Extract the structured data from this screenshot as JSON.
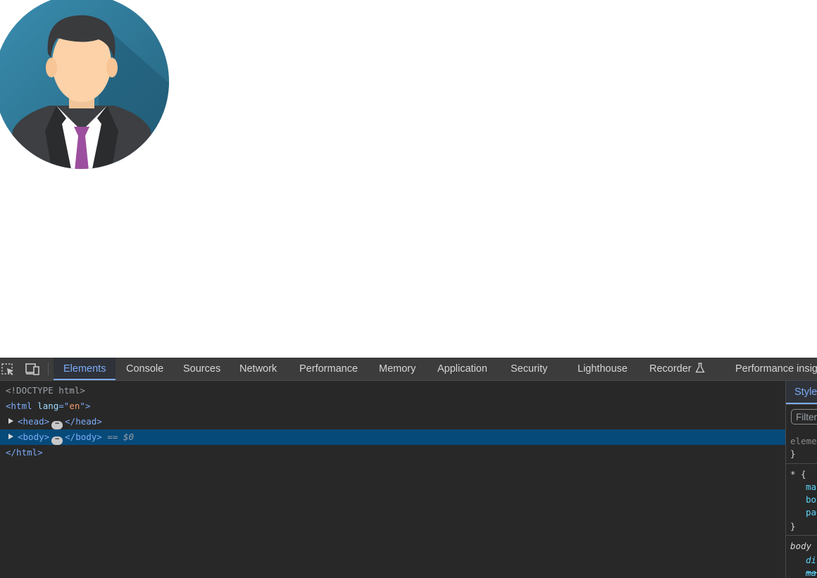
{
  "devtools": {
    "tabs": [
      {
        "label": "Elements"
      },
      {
        "label": "Console"
      },
      {
        "label": "Sources"
      },
      {
        "label": "Network"
      },
      {
        "label": "Performance"
      },
      {
        "label": "Memory"
      },
      {
        "label": "Application"
      },
      {
        "label": "Security"
      },
      {
        "label": "Lighthouse"
      },
      {
        "label": "Recorder"
      },
      {
        "label": "Performance insig"
      }
    ],
    "active_tab": "Elements",
    "dom": {
      "doctype": "<!DOCTYPE html>",
      "html_open_tag": "<html",
      "html_lang_attr": "lang",
      "html_lang_eq": "=\"",
      "html_lang_val": "en",
      "html_lang_close": "\">",
      "head_open": "<head>",
      "head_close": "</head>",
      "body_open": "<body>",
      "body_close": "</body>",
      "body_ref": "== $0",
      "html_close": "</html>",
      "ellipsis": "⋯"
    },
    "styles": {
      "tab_label": "Styles",
      "filter_placeholder": "Filter",
      "element_style": "element.style {",
      "close_brace": "}",
      "universal_selector": "* {",
      "prop_margin": "margin",
      "prop_box_sizing": "box-sizing",
      "prop_padding": "padding",
      "body_selector": "body",
      "body_prop_display": "display",
      "body_prop_margin": "margin"
    }
  },
  "colors": {
    "accent": "#7cacf8",
    "selected_row": "#064a7a",
    "toolbar_bg": "#3c3c3c",
    "panel_bg": "#282828",
    "avatar_bg": "#2f7898",
    "tie": "#9c4f9e"
  }
}
